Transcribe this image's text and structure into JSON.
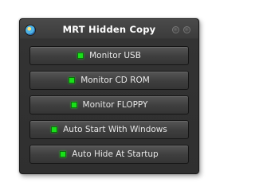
{
  "window": {
    "title": "MRT Hidden Copy"
  },
  "options": [
    {
      "label": "Monitor USB",
      "enabled": true,
      "indicator_color": "#19e019"
    },
    {
      "label": "Monitor CD ROM",
      "enabled": true,
      "indicator_color": "#19e019"
    },
    {
      "label": "Monitor FLOPPY",
      "enabled": true,
      "indicator_color": "#19e019"
    },
    {
      "label": "Auto Start With Windows",
      "enabled": true,
      "indicator_color": "#19e019"
    },
    {
      "label": "Auto Hide At Startup",
      "enabled": true,
      "indicator_color": "#19e019"
    }
  ],
  "colors": {
    "window_bg": "#2f2f2f",
    "text": "#e8e8e8",
    "indicator_on": "#19e019"
  },
  "icons": {
    "app": "app-icon",
    "minimize": "minimize-icon",
    "close": "close-icon"
  }
}
